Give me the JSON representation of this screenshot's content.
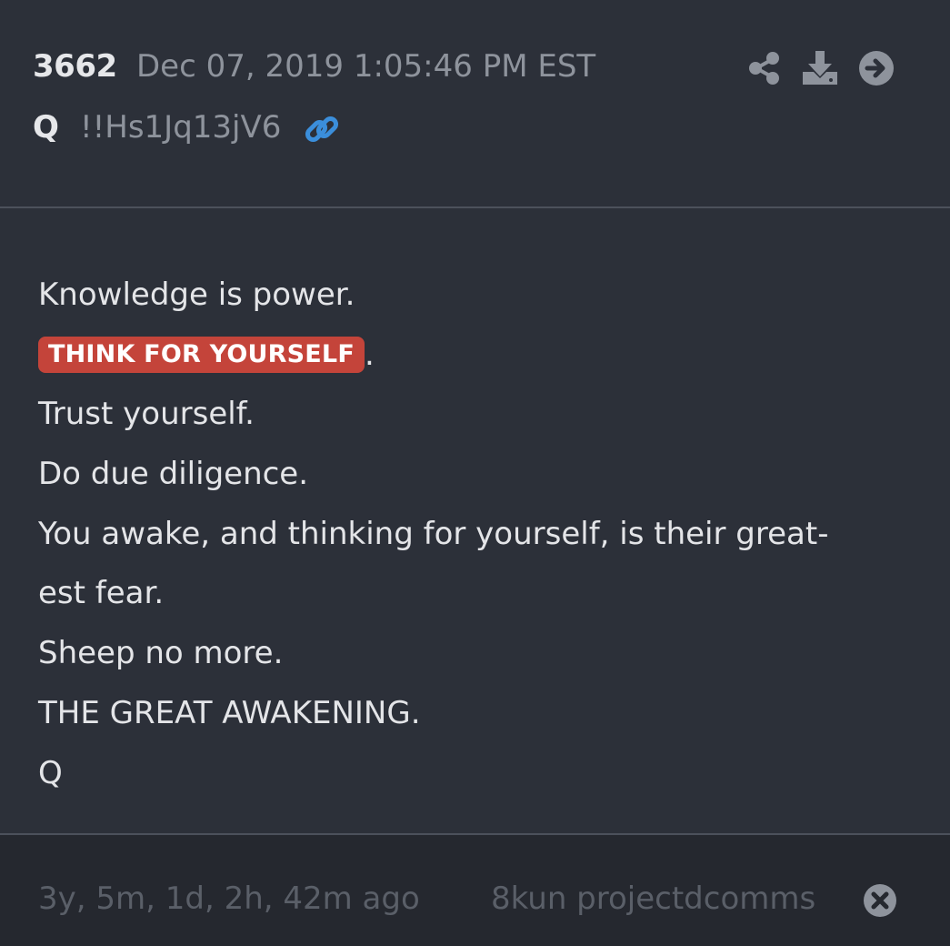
{
  "post": {
    "number": "3662",
    "date": "Dec 07, 2019 1:05:46 PM EST",
    "author": "Q",
    "tripcode": "!!Hs1Jq13jV6"
  },
  "icons": {
    "link": "link-icon",
    "share": "share-icon",
    "download": "download-icon",
    "next": "arrow-right-circle-icon",
    "close": "close-circle-icon"
  },
  "colors": {
    "background": "#2c3039",
    "footer_background": "#25282f",
    "highlight": "#c4443a",
    "link": "#3b8edb",
    "muted": "#8e939c"
  },
  "body": {
    "line1": "Knowledge is power.",
    "tag": "THINK FOR YOURSELF",
    "tag_suffix": ".",
    "line3": "Trust yourself.",
    "line4": "Do due diligence.",
    "line5": "You awake, and thinking for yourself, is their great-",
    "line6": "est fear.",
    "line7": "Sheep no more.",
    "line8": "THE GREAT AWAKENING.",
    "line9": "Q"
  },
  "footer": {
    "age": "3y, 5m, 1d, 2h, 42m ago",
    "source": "8kun projectdcomms"
  }
}
